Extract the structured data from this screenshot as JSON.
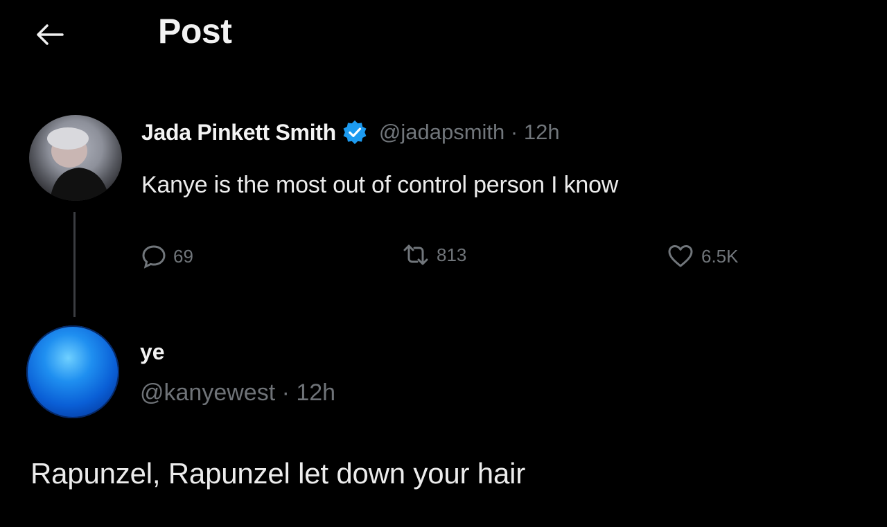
{
  "header": {
    "title": "Post",
    "back_icon": "arrow-left-icon"
  },
  "parent_tweet": {
    "display_name": "Jada Pinkett Smith",
    "verified": true,
    "handle": "@jadapsmith",
    "time": "12h",
    "meta": "@jadapsmith · 12h",
    "text": "Kanye is the most out of control person I know",
    "replies": "69",
    "retweets": "813",
    "likes": "6.5K"
  },
  "reply_tweet": {
    "display_name": "ye",
    "handle": "@kanyewest",
    "time": "12h",
    "meta": "@kanyewest · 12h",
    "text": "Rapunzel, Rapunzel let down your hair"
  },
  "colors": {
    "background": "#000000",
    "text": "#e7e9ea",
    "muted": "#71767b",
    "verified": "#1d9bf0"
  }
}
